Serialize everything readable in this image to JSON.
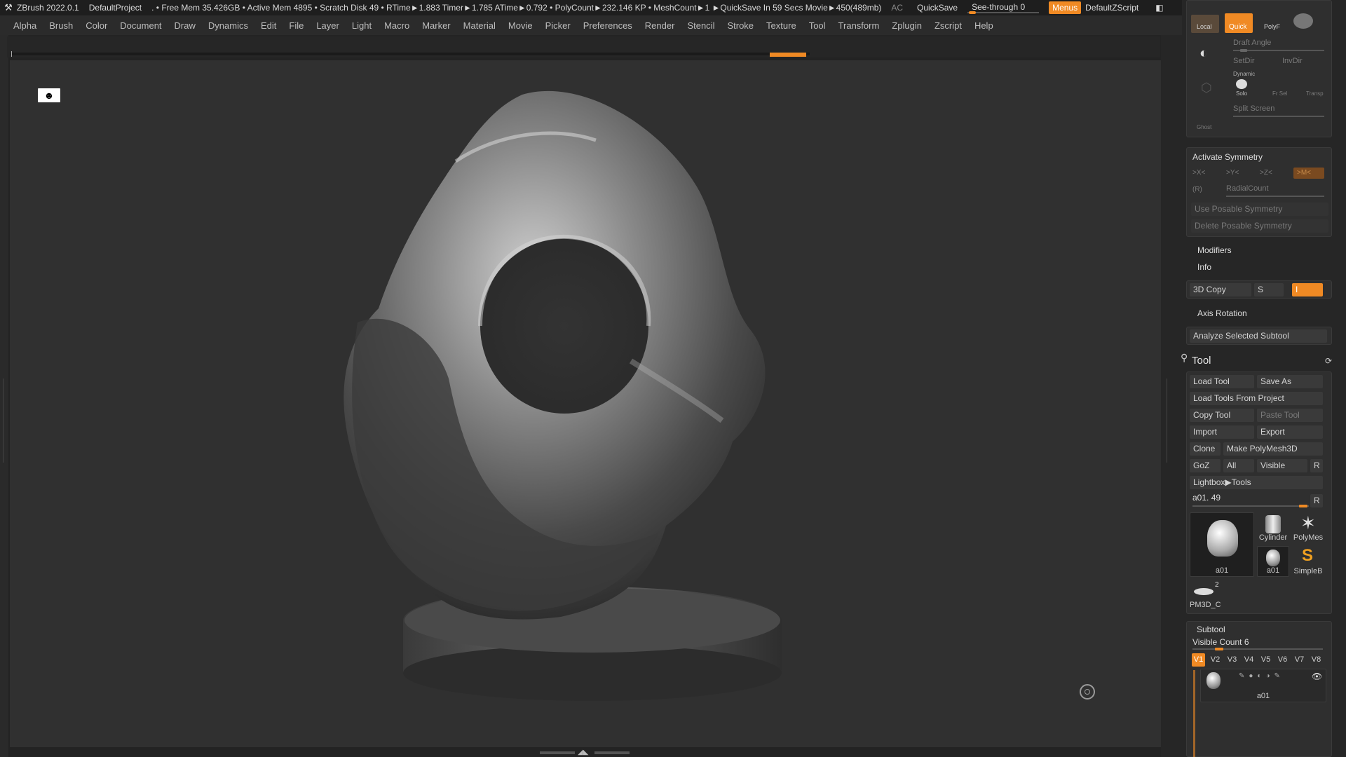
{
  "titlebar": {
    "app": "ZBrush 2022.0.1",
    "project": "DefaultProject",
    "status": ". • Free Mem 35.426GB • Active Mem 4895 • Scratch Disk 49 •  RTime►1.883 Timer►1.785 ATime►0.792 • PolyCount►232.146 KP  • MeshCount►1  ►QuickSave In 59 Secs Movie►450(489mb)",
    "ac": "AC",
    "quicksave": "QuickSave",
    "seethrough": "See-through  0",
    "menus": "Menus",
    "zscript": "DefaultZScript",
    "min": "—",
    "restore": "❐",
    "close": "✕"
  },
  "menu": [
    "Alpha",
    "Brush",
    "Color",
    "Document",
    "Draw",
    "Dynamics",
    "Edit",
    "File",
    "Layer",
    "Light",
    "Macro",
    "Marker",
    "Material",
    "Movie",
    "Picker",
    "Preferences",
    "Render",
    "Stencil",
    "Stroke",
    "Texture",
    "Tool",
    "Transform",
    "Zplugin",
    "Zscript",
    "Help"
  ],
  "right": {
    "top": {
      "local": "Local",
      "quick": "Quick",
      "polyf": "PolyF",
      "draft_angle": "Draft Angle",
      "setdir": "SetDir",
      "invdir": "InvDir",
      "dynamic": "Dynamic",
      "solo": "Solo",
      "frsel": "Fr Sel",
      "transp": "Transp",
      "split_screen": "Split Screen",
      "ghost": "Ghost"
    },
    "symmetry": {
      "activate": "Activate Symmetry",
      "x": ">X<",
      "y": ">Y<",
      "z": ">Z<",
      "m": ">M<",
      "r": "(R)",
      "radial": "RadialCount",
      "use_posable": "Use Posable Symmetry",
      "delete_posable": "Delete Posable Symmetry"
    },
    "modifiers": "Modifiers",
    "info": "Info",
    "copy3d": "3D Copy",
    "copy_s": "S",
    "copy_i": "I",
    "axis_rotation": "Axis Rotation",
    "analyze": "Analyze Selected Subtool",
    "tool": {
      "title": "Tool",
      "load": "Load Tool",
      "save_as": "Save As",
      "load_project": "Load Tools From Project",
      "copy": "Copy Tool",
      "paste": "Paste Tool",
      "import": "Import",
      "export": "Export",
      "clone": "Clone",
      "make_polymesh": "Make PolyMesh3D",
      "goz": "GoZ",
      "all": "All",
      "visible": "Visible",
      "r": "R",
      "lightbox": "Lightbox▶Tools",
      "current": "a01. 49",
      "current_r": "R",
      "thumbs": [
        "a01",
        "Cylinder",
        "PolyMes",
        "a01",
        "SimpleB",
        "PM3D_C"
      ],
      "badge": "2"
    },
    "subtool": {
      "title": "Subtool",
      "visible_count": "Visible Count 6",
      "tabs": [
        "V1",
        "V2",
        "V3",
        "V4",
        "V5",
        "V6",
        "V7",
        "V8"
      ],
      "item": "a01"
    }
  }
}
